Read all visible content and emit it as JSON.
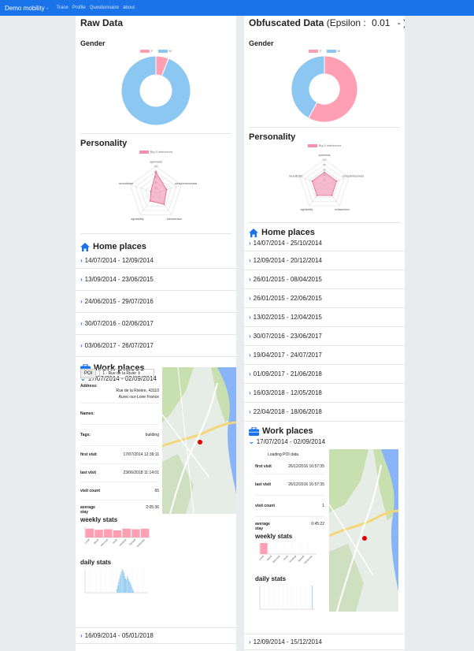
{
  "nav": {
    "brand": "Demo mobility -",
    "links": [
      "Trace",
      "Profile",
      "Questionnaire",
      "about"
    ]
  },
  "colors": {
    "navbar": "#1a73e8",
    "female": "#ff9fb4",
    "male": "#8cc7f2",
    "radar": "#f48fb1",
    "accent": "#1a73e8",
    "poi_marker": "#e00000"
  },
  "raw": {
    "title": "Raw Data",
    "gender": {
      "heading": "Gender",
      "legend": [
        "F",
        "M"
      ],
      "chart_data": {
        "type": "pie",
        "labels": [
          "F",
          "M"
        ],
        "values": [
          6,
          94
        ]
      }
    },
    "personality": {
      "heading": "Personality",
      "legend": "Big 5 inferences",
      "chart_data": {
        "type": "radar",
        "axes": [
          "openness",
          "conscientousness",
          "extraversion",
          "agreability",
          "neuroticism"
        ],
        "ticks": [
          "100",
          "80",
          "60",
          "40",
          "20"
        ],
        "values": [
          78,
          42,
          52,
          36,
          20
        ],
        "max": 100
      }
    },
    "home": {
      "heading": "Home places",
      "items": [
        "14/07/2014 - 12/09/2014",
        "13/09/2014 - 23/06/2015",
        "24/06/2015 - 29/07/2016",
        "30/07/2016 - 02/06/2017",
        "03/06/2017 - 26/07/2017"
      ]
    },
    "work": {
      "heading": "Work places",
      "open_item": "17/07/2014 - 02/09/2014",
      "poi_label": "POI",
      "poi_select": "1 - Rue de la Rivièr",
      "address_key": "Address:",
      "address_lines": [
        "Rue de la Rivière, 43110",
        "Aurec-sur-Loire France"
      ],
      "names_key": "Names:",
      "tags_key": "Tags:",
      "tags_val": "building",
      "first_key": "first visit",
      "first_val": "17/07/2014 12:39:11",
      "last_key": "last visit",
      "last_val": "23/06/2018 11:14:01",
      "count_key": "visit count",
      "count_val": "65",
      "avg_key": "average stay",
      "avg_val": "2:05:36",
      "weekly_heading": "weekly stats",
      "daily_heading": "daily stats",
      "weekly_days": [
        "Lundi",
        "Mardi",
        "Mercredi",
        "Jeudi",
        "Vendredi",
        "Samedi",
        "Dimanche"
      ],
      "chart_data": [
        {
          "type": "bar",
          "title": "weekly stats",
          "categories": [
            "Lundi",
            "Mardi",
            "Mercredi",
            "Jeudi",
            "Vendredi",
            "Samedi",
            "Dimanche"
          ],
          "values": [
            0.8,
            0.7,
            0.75,
            0.65,
            0.8,
            0.75,
            0.8
          ],
          "ylim": [
            0,
            1
          ]
        },
        {
          "type": "bar",
          "title": "daily stats",
          "values": [
            0,
            0,
            0,
            0,
            0,
            0,
            0,
            0,
            0,
            0,
            0,
            0,
            0,
            0,
            0,
            0,
            0,
            0,
            0,
            0,
            0,
            0,
            0,
            0,
            0,
            0,
            0,
            0,
            0,
            0,
            0,
            0,
            0,
            0,
            0,
            0,
            0.15,
            0.3,
            0.45,
            0.6,
            0.75,
            0.9,
            1.0,
            0.95,
            0.85,
            0.7,
            0.6,
            0.55,
            0.7,
            0.6,
            0.5,
            0.45,
            0.35,
            0.25,
            0.15,
            0.08,
            0,
            0,
            0,
            0,
            0,
            0,
            0,
            0,
            0,
            0,
            0,
            0,
            0,
            0,
            0,
            0
          ],
          "ylim": [
            0,
            1
          ]
        }
      ]
    },
    "next_item": "16/09/2014 - 05/01/2018"
  },
  "obf": {
    "title_bold": "Obfuscated Data",
    "title_rest": "(Epsilon :",
    "epsilon": "0.01",
    "epsilon_sep": "-",
    "title_end": ")",
    "gender": {
      "heading": "Gender",
      "legend": [
        "F",
        "M"
      ],
      "chart_data": {
        "type": "pie",
        "labels": [
          "F",
          "M"
        ],
        "values": [
          58,
          42
        ]
      }
    },
    "personality": {
      "heading": "Personality",
      "legend": "Big 5 inferences",
      "chart_data": {
        "type": "radar",
        "axes": [
          "openness",
          "conscientousness",
          "extraversion",
          "agreability",
          "neuroticism"
        ],
        "ticks": [
          "100",
          "80",
          "60",
          "40",
          "20"
        ],
        "values": [
          50,
          50,
          50,
          50,
          50
        ],
        "max": 100
      }
    },
    "home": {
      "heading": "Home places",
      "items": [
        "14/07/2014 - 25/10/2014",
        "12/09/2014 - 20/12/2014",
        "26/01/2015 - 08/04/2015",
        "26/01/2015 - 22/06/2015",
        "13/02/2015 - 12/04/2015",
        "30/07/2016 - 23/06/2017",
        "19/04/2017 - 24/07/2017",
        "01/09/2017 - 21/06/2018",
        "16/03/2018 - 12/05/2018",
        "22/04/2018 - 18/06/2018"
      ]
    },
    "work": {
      "heading": "Work places",
      "open_item": "17/07/2014 - 02/09/2014",
      "loading": "Loading POI data.",
      "first_key": "first visit",
      "first_val": "26/12/2016 16:57:35",
      "last_key": "last visit",
      "last_val": "26/12/2016 16:57:35",
      "count_key": "visit count",
      "count_val": "1",
      "avg_key": "average stay",
      "avg_val": "0:45:22",
      "weekly_heading": "weekly stats",
      "daily_heading": "daily stats",
      "chart_data": [
        {
          "type": "bar",
          "title": "weekly stats",
          "categories": [
            "Lundi",
            "Mardi",
            "Mercredi",
            "Jeudi",
            "Vendredi",
            "Samedi",
            "Dimanche"
          ],
          "values": [
            1,
            0,
            0,
            0,
            0,
            0,
            0
          ],
          "ylim": [
            0,
            1
          ]
        },
        {
          "type": "bar",
          "title": "daily stats",
          "values": [
            0,
            0,
            0,
            0,
            0,
            0,
            0,
            0,
            0,
            0,
            0,
            0,
            0,
            0,
            0,
            0,
            0,
            0,
            0,
            0,
            0,
            0,
            0,
            0,
            0,
            0,
            0,
            0,
            0,
            0,
            0,
            0,
            0,
            0,
            0,
            0,
            0,
            0,
            0,
            0,
            0,
            0,
            0,
            0,
            0,
            0,
            0,
            0,
            0,
            0,
            0,
            0,
            0,
            0,
            0,
            0,
            0,
            0,
            0,
            0,
            0,
            0,
            0,
            0,
            0,
            0,
            0,
            0,
            1,
            0,
            0,
            0
          ],
          "ylim": [
            0,
            1
          ]
        }
      ]
    },
    "next_item": "12/09/2014 - 15/12/2014"
  }
}
